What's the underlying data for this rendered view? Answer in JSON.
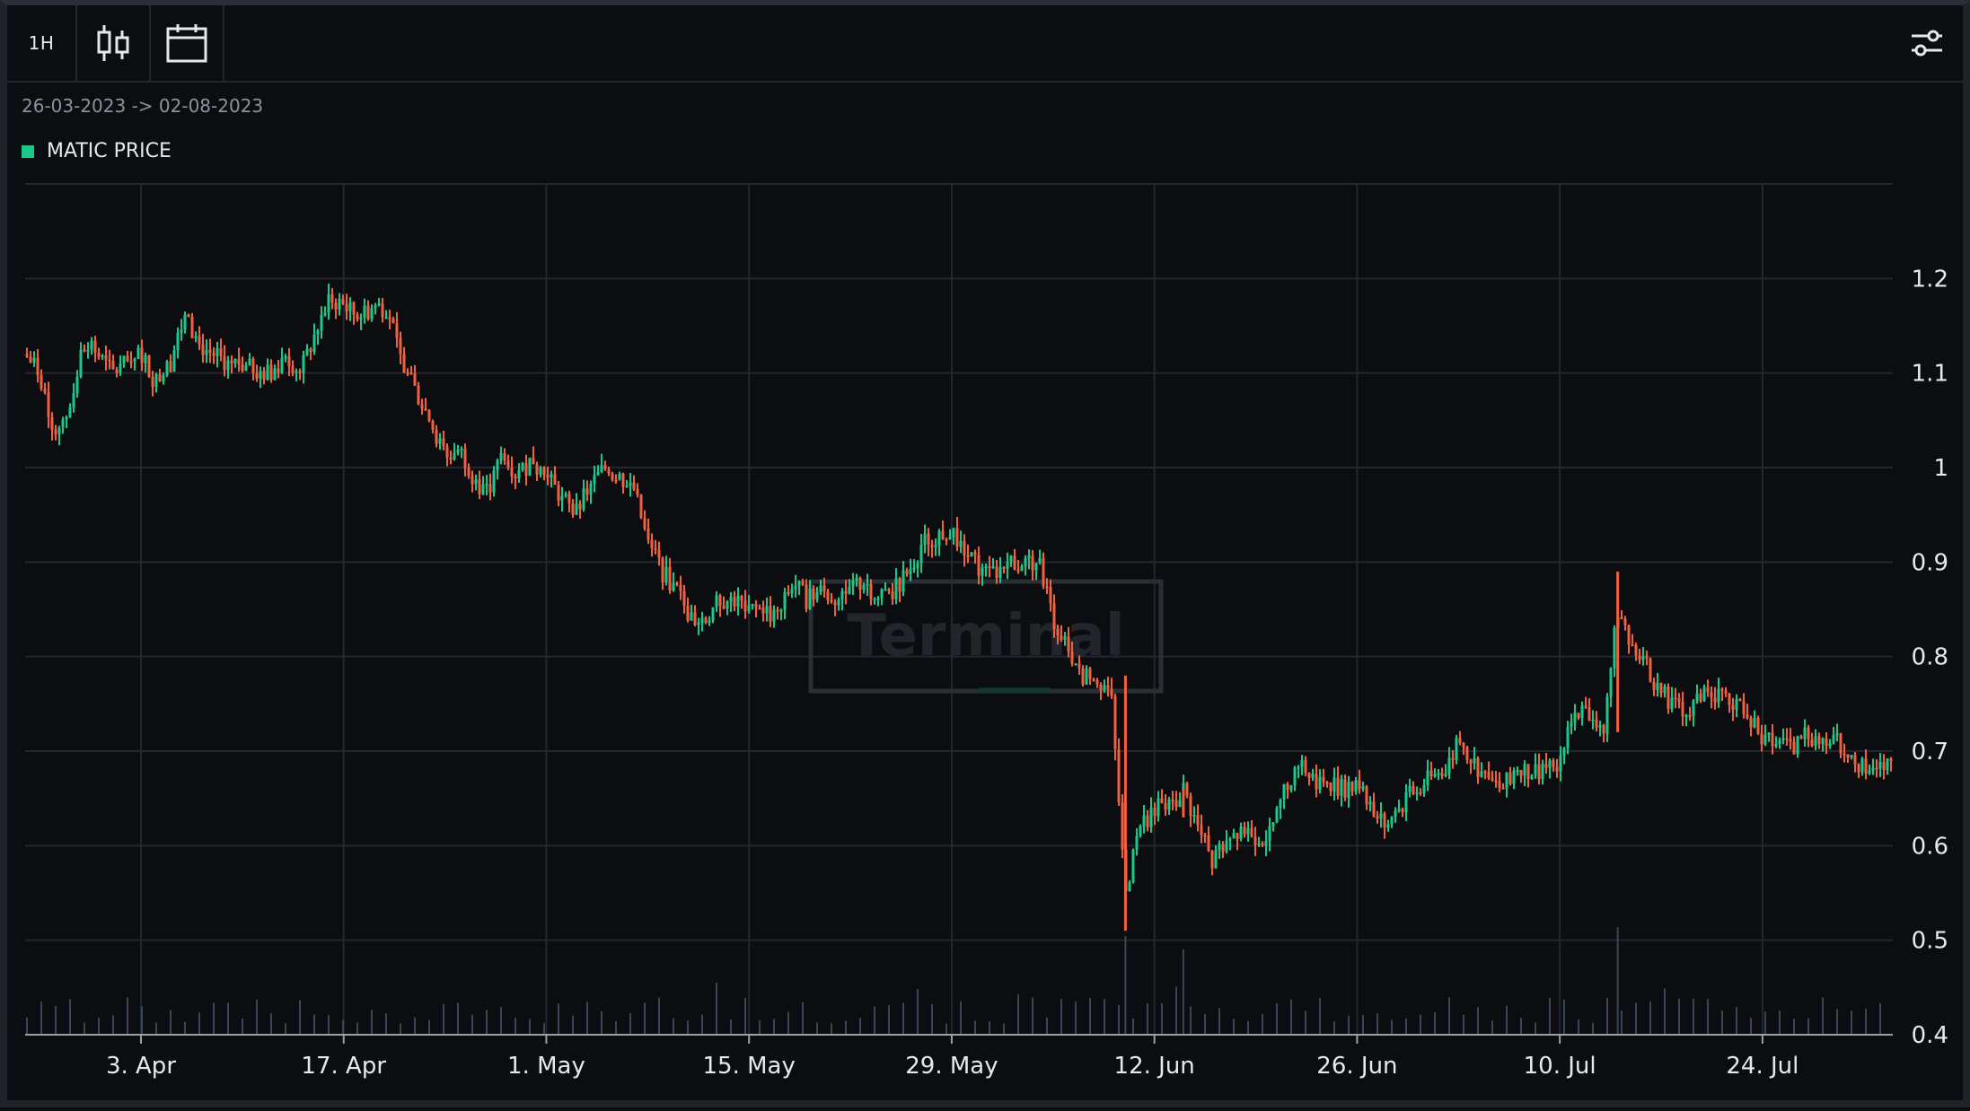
{
  "toolbar": {
    "interval_label": "1H",
    "candles_icon": "candlestick-icon",
    "calendar_icon": "calendar-icon",
    "settings_icon": "sliders-icon"
  },
  "date_range": "26-03-2023 -> 02-08-2023",
  "watermark": "Terminal",
  "colors": {
    "up": "#17c98a",
    "down": "#f2613f",
    "grid": "#23272e",
    "volume": "#3a4656",
    "background": "#0b0d10"
  },
  "chart_data": {
    "type": "candlestick",
    "legend": [
      {
        "name": "MATIC PRICE",
        "color": "#17c98a"
      }
    ],
    "x_range": [
      "2023-03-26",
      "2023-08-02"
    ],
    "x_ticks": [
      {
        "date": "2023-04-03",
        "label": "3. Apr"
      },
      {
        "date": "2023-04-17",
        "label": "17. Apr"
      },
      {
        "date": "2023-05-01",
        "label": "1. May"
      },
      {
        "date": "2023-05-15",
        "label": "15. May"
      },
      {
        "date": "2023-05-29",
        "label": "29. May"
      },
      {
        "date": "2023-06-12",
        "label": "12. Jun"
      },
      {
        "date": "2023-06-26",
        "label": "26. Jun"
      },
      {
        "date": "2023-07-10",
        "label": "10. Jul"
      },
      {
        "date": "2023-07-24",
        "label": "24. Jul"
      }
    ],
    "y_ticks": [
      {
        "value": 0.4,
        "label": "0.4"
      },
      {
        "value": 0.5,
        "label": "0.5"
      },
      {
        "value": 0.6,
        "label": "0.6"
      },
      {
        "value": 0.7,
        "label": "0.7"
      },
      {
        "value": 0.8,
        "label": "0.8"
      },
      {
        "value": 0.9,
        "label": "0.9"
      },
      {
        "value": 1.0,
        "label": "1"
      },
      {
        "value": 1.1,
        "label": "1.1"
      },
      {
        "value": 1.2,
        "label": "1.2"
      }
    ],
    "ylim": [
      0.4,
      1.3
    ],
    "close_path": [
      [
        "2023-03-26",
        1.12
      ],
      [
        "2023-03-27",
        1.1
      ],
      [
        "2023-03-28",
        1.04
      ],
      [
        "2023-03-29",
        1.06
      ],
      [
        "2023-03-30",
        1.13
      ],
      [
        "2023-03-31",
        1.12
      ],
      [
        "2023-04-01",
        1.1
      ],
      [
        "2023-04-02",
        1.11
      ],
      [
        "2023-04-03",
        1.12
      ],
      [
        "2023-04-04",
        1.09
      ],
      [
        "2023-04-05",
        1.11
      ],
      [
        "2023-04-06",
        1.16
      ],
      [
        "2023-04-07",
        1.13
      ],
      [
        "2023-04-08",
        1.12
      ],
      [
        "2023-04-09",
        1.11
      ],
      [
        "2023-04-10",
        1.11
      ],
      [
        "2023-04-11",
        1.1
      ],
      [
        "2023-04-12",
        1.1
      ],
      [
        "2023-04-13",
        1.12
      ],
      [
        "2023-04-14",
        1.1
      ],
      [
        "2023-04-15",
        1.14
      ],
      [
        "2023-04-16",
        1.18
      ],
      [
        "2023-04-17",
        1.17
      ],
      [
        "2023-04-18",
        1.16
      ],
      [
        "2023-04-19",
        1.17
      ],
      [
        "2023-04-20",
        1.17
      ],
      [
        "2023-04-21",
        1.11
      ],
      [
        "2023-04-22",
        1.08
      ],
      [
        "2023-04-23",
        1.05
      ],
      [
        "2023-04-24",
        1.01
      ],
      [
        "2023-04-25",
        1.02
      ],
      [
        "2023-04-26",
        0.99
      ],
      [
        "2023-04-27",
        0.97
      ],
      [
        "2023-04-28",
        1.02
      ],
      [
        "2023-04-29",
        0.99
      ],
      [
        "2023-04-30",
        1.01
      ],
      [
        "2023-05-01",
        0.99
      ],
      [
        "2023-05-02",
        0.97
      ],
      [
        "2023-05-03",
        0.95
      ],
      [
        "2023-05-04",
        0.98
      ],
      [
        "2023-05-05",
        1.0
      ],
      [
        "2023-05-06",
        0.99
      ],
      [
        "2023-05-07",
        0.98
      ],
      [
        "2023-05-08",
        0.92
      ],
      [
        "2023-05-09",
        0.89
      ],
      [
        "2023-05-10",
        0.87
      ],
      [
        "2023-05-11",
        0.84
      ],
      [
        "2023-05-12",
        0.84
      ],
      [
        "2023-05-13",
        0.86
      ],
      [
        "2023-05-14",
        0.86
      ],
      [
        "2023-05-15",
        0.85
      ],
      [
        "2023-05-16",
        0.85
      ],
      [
        "2023-05-17",
        0.84
      ],
      [
        "2023-05-18",
        0.88
      ],
      [
        "2023-05-19",
        0.86
      ],
      [
        "2023-05-20",
        0.87
      ],
      [
        "2023-05-21",
        0.86
      ],
      [
        "2023-05-22",
        0.87
      ],
      [
        "2023-05-23",
        0.88
      ],
      [
        "2023-05-24",
        0.86
      ],
      [
        "2023-05-25",
        0.87
      ],
      [
        "2023-05-26",
        0.89
      ],
      [
        "2023-05-27",
        0.92
      ],
      [
        "2023-05-28",
        0.93
      ],
      [
        "2023-05-29",
        0.93
      ],
      [
        "2023-05-30",
        0.91
      ],
      [
        "2023-05-31",
        0.89
      ],
      [
        "2023-06-01",
        0.89
      ],
      [
        "2023-06-02",
        0.9
      ],
      [
        "2023-06-03",
        0.9
      ],
      [
        "2023-06-04",
        0.9
      ],
      [
        "2023-06-05",
        0.84
      ],
      [
        "2023-06-06",
        0.81
      ],
      [
        "2023-06-07",
        0.78
      ],
      [
        "2023-06-08",
        0.78
      ],
      [
        "2023-06-09",
        0.76
      ],
      [
        "2023-06-10",
        0.55
      ],
      [
        "2023-06-11",
        0.62
      ],
      [
        "2023-06-12",
        0.64
      ],
      [
        "2023-06-13",
        0.64
      ],
      [
        "2023-06-14",
        0.66
      ],
      [
        "2023-06-15",
        0.62
      ],
      [
        "2023-06-16",
        0.58
      ],
      [
        "2023-06-17",
        0.61
      ],
      [
        "2023-06-18",
        0.62
      ],
      [
        "2023-06-19",
        0.61
      ],
      [
        "2023-06-20",
        0.61
      ],
      [
        "2023-06-21",
        0.66
      ],
      [
        "2023-06-22",
        0.69
      ],
      [
        "2023-06-23",
        0.67
      ],
      [
        "2023-06-24",
        0.67
      ],
      [
        "2023-06-25",
        0.66
      ],
      [
        "2023-06-26",
        0.67
      ],
      [
        "2023-06-27",
        0.64
      ],
      [
        "2023-06-28",
        0.62
      ],
      [
        "2023-06-29",
        0.64
      ],
      [
        "2023-06-30",
        0.66
      ],
      [
        "2023-07-01",
        0.67
      ],
      [
        "2023-07-02",
        0.68
      ],
      [
        "2023-07-03",
        0.71
      ],
      [
        "2023-07-04",
        0.69
      ],
      [
        "2023-07-05",
        0.67
      ],
      [
        "2023-07-06",
        0.66
      ],
      [
        "2023-07-07",
        0.68
      ],
      [
        "2023-07-08",
        0.68
      ],
      [
        "2023-07-09",
        0.68
      ],
      [
        "2023-07-10",
        0.69
      ],
      [
        "2023-07-11",
        0.74
      ],
      [
        "2023-07-12",
        0.74
      ],
      [
        "2023-07-13",
        0.72
      ],
      [
        "2023-07-14",
        0.85
      ],
      [
        "2023-07-15",
        0.81
      ],
      [
        "2023-07-16",
        0.79
      ],
      [
        "2023-07-17",
        0.76
      ],
      [
        "2023-07-18",
        0.75
      ],
      [
        "2023-07-19",
        0.74
      ],
      [
        "2023-07-20",
        0.77
      ],
      [
        "2023-07-21",
        0.76
      ],
      [
        "2023-07-22",
        0.75
      ],
      [
        "2023-07-23",
        0.74
      ],
      [
        "2023-07-24",
        0.71
      ],
      [
        "2023-07-25",
        0.71
      ],
      [
        "2023-07-26",
        0.7
      ],
      [
        "2023-07-27",
        0.72
      ],
      [
        "2023-07-28",
        0.71
      ],
      [
        "2023-07-29",
        0.71
      ],
      [
        "2023-07-30",
        0.7
      ],
      [
        "2023-07-31",
        0.68
      ],
      [
        "2023-08-01",
        0.68
      ],
      [
        "2023-08-02",
        0.69
      ]
    ]
  }
}
